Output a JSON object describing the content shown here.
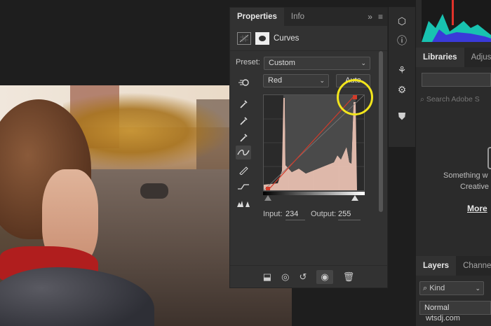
{
  "properties": {
    "tabs": [
      "Properties",
      "Info"
    ],
    "panel_menu_chevrons": "»",
    "header_title": "Curves",
    "preset_label": "Preset:",
    "preset_value": "Custom",
    "channel_value": "Red",
    "auto_label": "Auto",
    "input_label": "Input:",
    "input_value": "234",
    "output_label": "Output:",
    "output_value": "255"
  },
  "libraries": {
    "tabs": [
      "Libraries",
      "Adjust"
    ],
    "search_placeholder": "Search Adobe S",
    "message_line1": "Something w",
    "message_line2": "Creative",
    "more_link": "More"
  },
  "layers": {
    "tabs": [
      "Layers",
      "Channel"
    ],
    "kind_label": "Kind",
    "blend_mode": "Normal"
  },
  "colors": {
    "highlight_circle": "#f2e51c",
    "curve_red": "#d23b2a",
    "histogram_fill": "#f2c8b8"
  },
  "watermark": "wtsdj.com"
}
